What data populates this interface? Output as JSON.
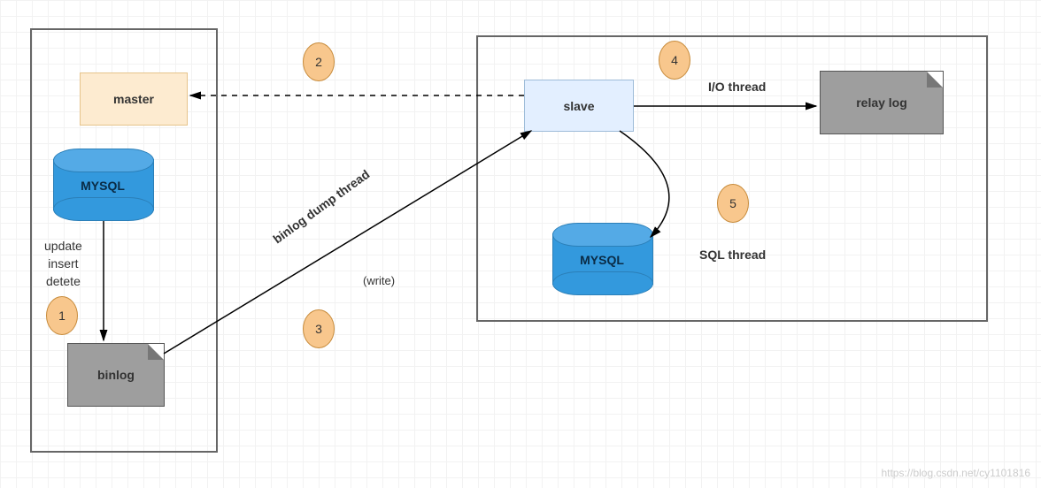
{
  "diagram": {
    "boxes": {
      "master": {
        "label": "master"
      },
      "slave": {
        "label": "slave"
      }
    },
    "db": {
      "master": {
        "label": "MYSQL"
      },
      "slave": {
        "label": "MYSQL"
      }
    },
    "docs": {
      "binlog": {
        "label": "binlog"
      },
      "relaylog": {
        "label": "relay log"
      }
    },
    "labels": {
      "ops": "update\ninsert\ndetete",
      "binlog_dump": "binlog dump thread",
      "write": "(write)",
      "io_thread": "I/O thread",
      "sql_thread": "SQL thread"
    },
    "badges": {
      "b1": "1",
      "b2": "2",
      "b3": "3",
      "b4": "4",
      "b5": "5"
    },
    "watermark": "https://blog.csdn.net/cy1101816"
  },
  "colors": {
    "outline": "#666666",
    "master_fill": "#fdebd0",
    "slave_fill": "#e3efff",
    "cylinder": "#3399dd",
    "doc_fill": "#9e9e9e",
    "badge_fill": "#f8c78d"
  },
  "chart_data": {
    "type": "diagram",
    "title": "MySQL master-slave replication",
    "nodes": [
      {
        "id": "master",
        "type": "process",
        "label": "master",
        "container": "master-box"
      },
      {
        "id": "master_db",
        "type": "database",
        "label": "MYSQL",
        "container": "master-box"
      },
      {
        "id": "binlog",
        "type": "file",
        "label": "binlog",
        "container": "master-box"
      },
      {
        "id": "slave",
        "type": "process",
        "label": "slave",
        "container": "slave-box"
      },
      {
        "id": "slave_db",
        "type": "database",
        "label": "MYSQL",
        "container": "slave-box"
      },
      {
        "id": "relaylog",
        "type": "file",
        "label": "relay log",
        "container": "slave-box"
      }
    ],
    "edges": [
      {
        "from": "master_db",
        "to": "binlog",
        "label": "update insert detete",
        "step": 1
      },
      {
        "from": "slave",
        "to": "master",
        "label": null,
        "style": "dashed",
        "step": 2
      },
      {
        "from": "binlog",
        "to": "slave",
        "label": "binlog dump thread (write)",
        "step": 3
      },
      {
        "from": "slave",
        "to": "relaylog",
        "label": "I/O thread",
        "step": 4
      },
      {
        "from": "slave",
        "to": "slave_db",
        "label": "SQL thread",
        "step": 5
      }
    ]
  }
}
